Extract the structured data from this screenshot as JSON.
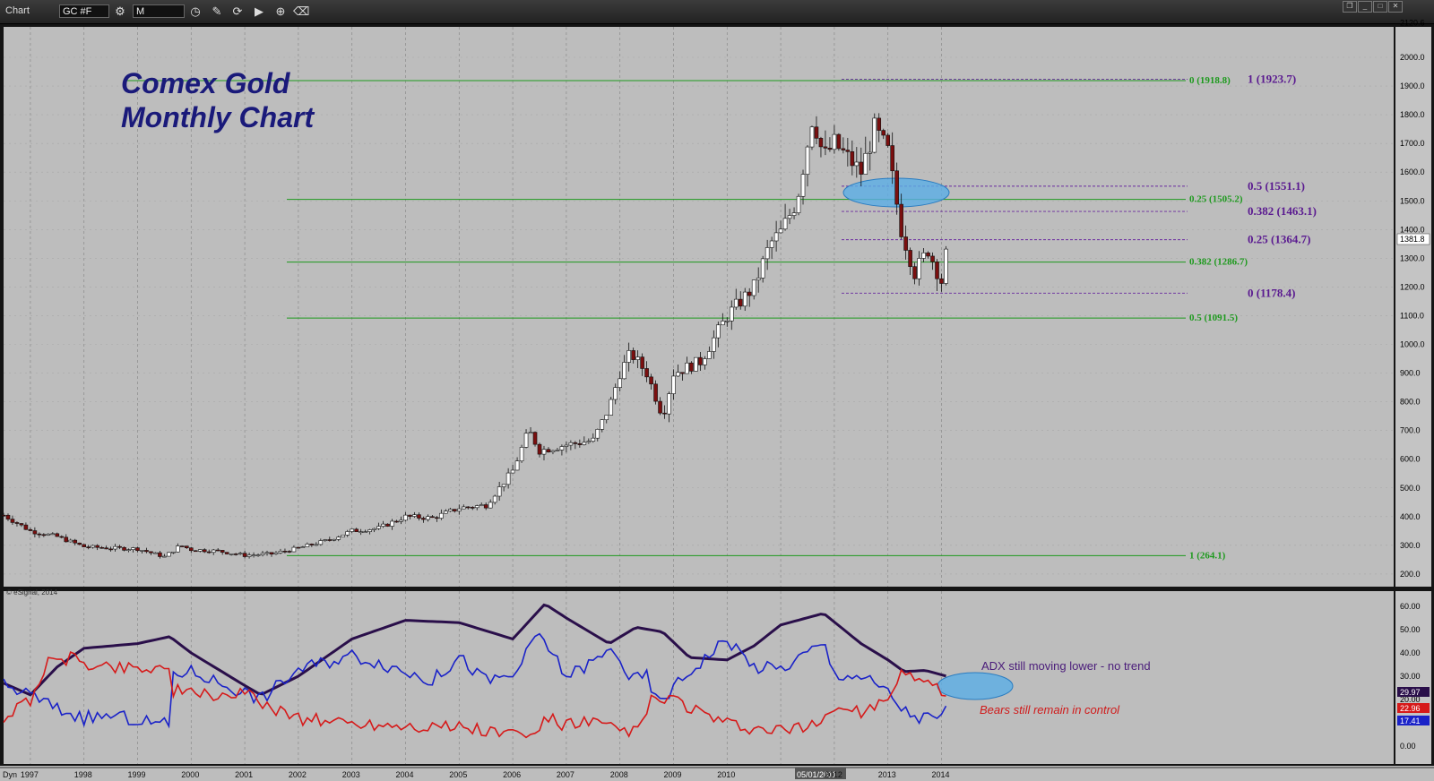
{
  "window": {
    "title": "Chart",
    "symbol": "GC #F",
    "interval": "M"
  },
  "chart_data": [
    {
      "type": "candlestick",
      "title": "Comex Gold\nMonthly Chart",
      "title_lines": [
        "Comex Gold",
        "Monthly Chart"
      ],
      "ylim": [
        150,
        2120.6
      ],
      "y_ticks": [
        "2120.6",
        "2000.0",
        "1900.0",
        "1800.0",
        "1700.0",
        "1600.0",
        "1500.0",
        "1400.0",
        "1300.0",
        "1200.0",
        "1100.0",
        "1000.0",
        "900.0",
        "800.0",
        "700.0",
        "600.0",
        "500.0",
        "400.0",
        "300.0",
        "200.0"
      ],
      "last_price": "1381.8",
      "copyright": "© eSignal, 2014",
      "close_series_anchors": [
        [
          1996.5,
          405
        ],
        [
          1997,
          350
        ],
        [
          1997.5,
          330
        ],
        [
          1998,
          295
        ],
        [
          1998.5,
          290
        ],
        [
          1999,
          288
        ],
        [
          1999.5,
          260
        ],
        [
          1999.8,
          300
        ],
        [
          2000,
          285
        ],
        [
          2000.5,
          280
        ],
        [
          2001,
          265
        ],
        [
          2001.5,
          270
        ],
        [
          2002,
          290
        ],
        [
          2002.5,
          315
        ],
        [
          2003,
          350
        ],
        [
          2003.5,
          360
        ],
        [
          2004,
          400
        ],
        [
          2004.5,
          395
        ],
        [
          2005,
          430
        ],
        [
          2005.5,
          440
        ],
        [
          2006,
          560
        ],
        [
          2006.3,
          700
        ],
        [
          2006.5,
          630
        ],
        [
          2007,
          650
        ],
        [
          2007.5,
          665
        ],
        [
          2007.8,
          780
        ],
        [
          2008,
          900
        ],
        [
          2008.2,
          970
        ],
        [
          2008.5,
          900
        ],
        [
          2008.8,
          750
        ],
        [
          2009,
          900
        ],
        [
          2009.5,
          940
        ],
        [
          2010,
          1100
        ],
        [
          2010.5,
          1200
        ],
        [
          2010.8,
          1350
        ],
        [
          2011,
          1390
        ],
        [
          2011.3,
          1500
        ],
        [
          2011.6,
          1800
        ],
        [
          2011.8,
          1650
        ],
        [
          2012,
          1700
        ],
        [
          2012.5,
          1600
        ],
        [
          2012.75,
          1750
        ],
        [
          2013,
          1670
        ],
        [
          2013.25,
          1400
        ],
        [
          2013.5,
          1250
        ],
        [
          2013.75,
          1330
        ],
        [
          2014,
          1220
        ],
        [
          2014.15,
          1381.8
        ]
      ]
    },
    {
      "type": "line",
      "title": "",
      "ylim": [
        0,
        65
      ],
      "y_ticks": [
        "60.00",
        "50.00",
        "40.00",
        "30.00",
        "20.00",
        "10.00",
        "0.00"
      ],
      "series": [
        {
          "name": "ADX",
          "color": "#2a0f4a",
          "last_value": "29.97",
          "anchors": [
            [
              1996.5,
              27
            ],
            [
              1997,
              22
            ],
            [
              1997.5,
              34
            ],
            [
              1998,
              42
            ],
            [
              1999,
              44
            ],
            [
              1999.6,
              47
            ],
            [
              2000,
              40
            ],
            [
              2001,
              26
            ],
            [
              2001.3,
              22
            ],
            [
              2002,
              30
            ],
            [
              2003,
              46
            ],
            [
              2004,
              54
            ],
            [
              2005,
              53
            ],
            [
              2006,
              46
            ],
            [
              2006.6,
              61
            ],
            [
              2007,
              55
            ],
            [
              2007.8,
              44
            ],
            [
              2008.3,
              51
            ],
            [
              2008.8,
              49
            ],
            [
              2009.3,
              38
            ],
            [
              2010,
              37
            ],
            [
              2010.5,
              43
            ],
            [
              2011,
              52
            ],
            [
              2011.8,
              57
            ],
            [
              2012.5,
              44
            ],
            [
              2013,
              37
            ],
            [
              2013.3,
              32
            ],
            [
              2013.7,
              32.5
            ],
            [
              2014.1,
              29.97
            ]
          ]
        },
        {
          "name": "+DI",
          "color": "#1a22c8",
          "last_value": "17.41",
          "anchors": [
            [
              1996.5,
              26
            ],
            [
              1997,
              22
            ],
            [
              1997.5,
              16
            ],
            [
              1998,
              12
            ],
            [
              1998.5,
              13
            ],
            [
              1999,
              11
            ],
            [
              1999.6,
              9
            ],
            [
              1999.65,
              31
            ],
            [
              2000,
              32
            ],
            [
              2001,
              23
            ],
            [
              2001.3,
              20
            ],
            [
              2002,
              33
            ],
            [
              2003,
              39
            ],
            [
              2003.5,
              36
            ],
            [
              2004,
              32
            ],
            [
              2004.5,
              28
            ],
            [
              2005,
              38
            ],
            [
              2005.5,
              28
            ],
            [
              2006,
              30
            ],
            [
              2006.5,
              48
            ],
            [
              2007,
              30
            ],
            [
              2007.5,
              36
            ],
            [
              2007.9,
              42
            ],
            [
              2008.2,
              28
            ],
            [
              2008.5,
              30
            ],
            [
              2008.7,
              18
            ],
            [
              2009,
              25
            ],
            [
              2009.5,
              36
            ],
            [
              2010,
              46
            ],
            [
              2010.5,
              34
            ],
            [
              2011,
              33
            ],
            [
              2011.5,
              40
            ],
            [
              2011.8,
              44
            ],
            [
              2012,
              31
            ],
            [
              2012.5,
              30
            ],
            [
              2013,
              23
            ],
            [
              2013.3,
              15
            ],
            [
              2013.6,
              12
            ],
            [
              2014,
              12
            ],
            [
              2014.15,
              17.41
            ]
          ]
        },
        {
          "name": "-DI",
          "color": "#d61a1a",
          "last_value": "22.96",
          "anchors": [
            [
              1996.5,
              12
            ],
            [
              1997,
              20
            ],
            [
              1997.3,
              35
            ],
            [
              1997.8,
              38
            ],
            [
              1998.3,
              34
            ],
            [
              1999,
              34
            ],
            [
              1999.6,
              33
            ],
            [
              1999.65,
              24
            ],
            [
              2000,
              22
            ],
            [
              2001,
              22
            ],
            [
              2001.5,
              17
            ],
            [
              2002,
              12
            ],
            [
              2003,
              10
            ],
            [
              2004,
              9
            ],
            [
              2005,
              8
            ],
            [
              2006,
              5
            ],
            [
              2006.4,
              4
            ],
            [
              2006.6,
              12
            ],
            [
              2007,
              9
            ],
            [
              2007.5,
              10
            ],
            [
              2008,
              6
            ],
            [
              2008.4,
              8
            ],
            [
              2008.6,
              20
            ],
            [
              2009,
              20
            ],
            [
              2009.5,
              14
            ],
            [
              2010,
              9
            ],
            [
              2010.5,
              7
            ],
            [
              2011,
              6
            ],
            [
              2011.5,
              8
            ],
            [
              2012,
              16
            ],
            [
              2012.5,
              15
            ],
            [
              2013,
              18
            ],
            [
              2013.2,
              30
            ],
            [
              2013.5,
              31
            ],
            [
              2013.8,
              27
            ],
            [
              2014.15,
              22.96
            ]
          ]
        }
      ]
    }
  ],
  "x_axis": {
    "labels": [
      "Dyn",
      "1997",
      "1998",
      "1999",
      "2000",
      "2001",
      "2002",
      "2003",
      "2004",
      "2005",
      "2006",
      "2007",
      "2008",
      "2009",
      "2010",
      "05/01/2011",
      "2012",
      "2013",
      "2014"
    ]
  },
  "fib_levels": {
    "green": [
      {
        "label": "0 (1918.8)",
        "price": 1918.8
      },
      {
        "label": "0.25 (1505.2)",
        "price": 1505.2
      },
      {
        "label": "0.382 (1286.7)",
        "price": 1286.7
      },
      {
        "label": "0.5 (1091.5)",
        "price": 1091.5
      },
      {
        "label": "1 (264.1)",
        "price": 264.1
      }
    ],
    "purple": [
      {
        "label": "1 (1923.7)",
        "price": 1923.7
      },
      {
        "label": "0.5 (1551.1)",
        "price": 1551.1
      },
      {
        "label": "0.382 (1463.1)",
        "price": 1463.1
      },
      {
        "label": "0.25 (1364.7)",
        "price": 1364.7
      },
      {
        "label": "0 (1178.4)",
        "price": 1178.4
      }
    ]
  },
  "annotations": {
    "adx_note": "ADX still moving lower - no trend",
    "bears_note": "Bears still remain in control"
  },
  "colors": {
    "chart_bg": "#bdbdbd",
    "bull_candle": "#ffffff",
    "bear_candle": "#7a0f0f",
    "fib_green": "#1e9a1e",
    "fib_purple": "#5a1a90",
    "highlight": "#5aaee6"
  }
}
